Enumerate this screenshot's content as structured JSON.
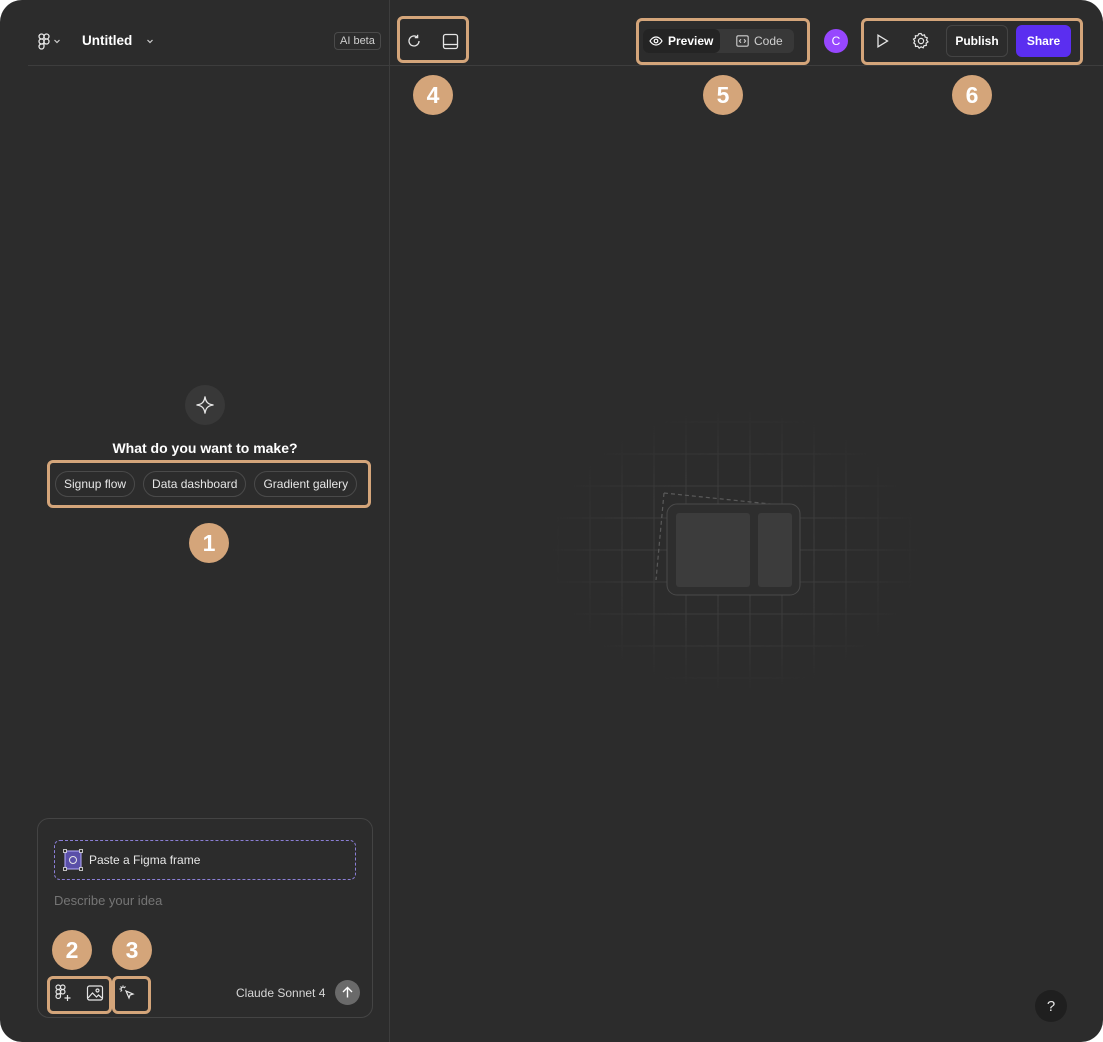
{
  "header": {
    "file_title": "Untitled",
    "ai_badge": "AI beta"
  },
  "empty_state": {
    "question": "What do you want to make?",
    "suggestions": [
      "Signup flow",
      "Data dashboard",
      "Gradient gallery"
    ]
  },
  "composer": {
    "paste_label": "Paste a Figma frame",
    "placeholder": "Describe your idea",
    "model": "Claude Sonnet 4"
  },
  "toolbar": {
    "preview_label": "Preview",
    "code_label": "Code",
    "avatar_initial": "C",
    "publish_label": "Publish",
    "share_label": "Share"
  },
  "help": {
    "label": "?"
  },
  "annotations": [
    "1",
    "2",
    "3",
    "4",
    "5",
    "6"
  ],
  "colors": {
    "background": "#2c2c2c",
    "accent_share": "#5b2ef0",
    "avatar": "#9747ff",
    "annotation": "#d4a57a"
  }
}
